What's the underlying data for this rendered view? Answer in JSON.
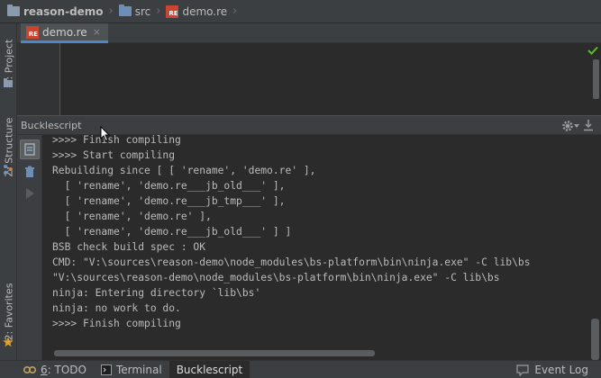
{
  "breadcrumb": {
    "project": "reason-demo",
    "folder": "src",
    "file": "demo.re",
    "re_badge": "RE"
  },
  "left_strip": {
    "project_tab": "1: Project",
    "structure_tab": "Z: Structure",
    "favorites_tab": "2: Favorites"
  },
  "editor": {
    "tab_label": "demo.re",
    "tab_close": "×",
    "status": "ok"
  },
  "panel": {
    "title": "Bucklescript"
  },
  "console": {
    "lines": [
      ">>>> Finish compiling",
      ">>>> Start compiling",
      "Rebuilding since [ [ 'rename', 'demo.re' ],",
      "  [ 'rename', 'demo.re___jb_old___' ],",
      "  [ 'rename', 'demo.re___jb_tmp___' ],",
      "  [ 'rename', 'demo.re' ],",
      "  [ 'rename', 'demo.re___jb_old___' ] ]",
      "BSB check build spec : OK",
      "CMD: \"V:\\sources\\reason-demo\\node_modules\\bs-platform\\bin\\ninja.exe\" -C lib\\bs",
      "\"V:\\sources\\reason-demo\\node_modules\\bs-platform\\bin\\ninja.exe\" -C lib\\bs",
      "ninja: Entering directory `lib\\bs'",
      "ninja: no work to do.",
      ">>>> Finish compiling"
    ]
  },
  "bottom_bar": {
    "todo_prefix": "6",
    "todo_label": ": TODO",
    "terminal_label": "Terminal",
    "bucklescript_label": "Bucklescript",
    "event_log_label": "Event Log"
  },
  "colors": {
    "background": "#2b2b2b",
    "panel": "#3c3f41",
    "accent": "#4a88c7",
    "re_badge": "#c9452f",
    "check": "#5fb833"
  },
  "icons": {
    "folder": "folder-icon",
    "re_file": "reason-file-icon",
    "check": "check-icon",
    "gear": "gear-icon",
    "pin": "hide-panel-icon",
    "rerun": "rerun-icon",
    "trash": "trash-icon",
    "run": "run-icon",
    "todo": "todo-icon",
    "terminal": "terminal-icon",
    "event_log": "event-log-icon",
    "favorites": "star-icon"
  }
}
